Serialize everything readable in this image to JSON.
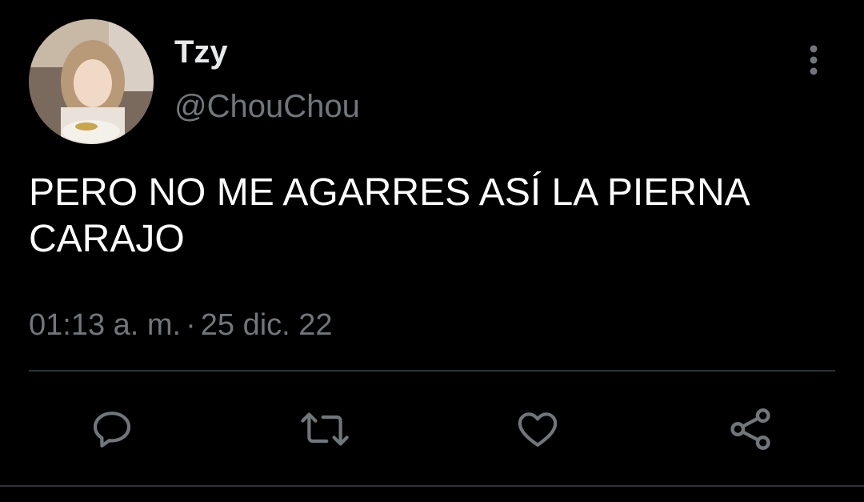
{
  "user": {
    "display_name": "Tzy",
    "handle": "@ChouChou",
    "avatar_icon": "profile-photo"
  },
  "tweet": {
    "text": "PERO NO ME AGARRES ASÍ LA PIERNA\nCARAJO",
    "time": "01:13 a. m.",
    "separator": "·",
    "date": "25 dic. 22"
  },
  "actions": [
    {
      "icon": "reply-icon"
    },
    {
      "icon": "retweet-icon"
    },
    {
      "icon": "like-icon"
    },
    {
      "icon": "share-icon"
    }
  ],
  "colors": {
    "background": "#000000",
    "primary_text": "#e7e9ea",
    "secondary_text": "#71767b",
    "divider": "#2f3336"
  }
}
